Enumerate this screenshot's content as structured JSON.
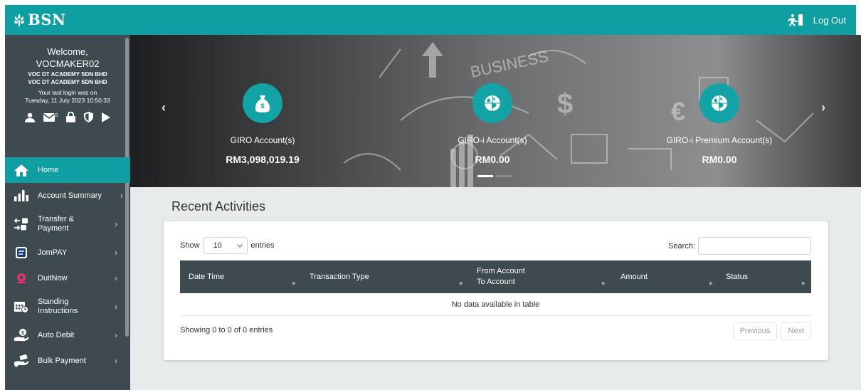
{
  "header": {
    "logo_text": "BSN",
    "logout_label": "Log Out"
  },
  "profile": {
    "welcome": "Welcome,",
    "username": "VOCMAKER02",
    "company_line1": "VOC DT ACADEMY SDN BHD",
    "company_line2": "VOC DT ACADEMY SDN BHD",
    "last_login_label": "Your last login was on",
    "last_login_time": "Tuesday, 11 July 2023 10:50:33",
    "mail_count": "0"
  },
  "sidebar": {
    "items": [
      {
        "label": "Home"
      },
      {
        "label": "Account Summary"
      },
      {
        "label_1": "Transfer &",
        "label_2": "Payment"
      },
      {
        "label": "JomPAY"
      },
      {
        "label": "DuitNow"
      },
      {
        "label_1": "Standing",
        "label_2": "Instructions"
      },
      {
        "label": "Auto Debit"
      },
      {
        "label": "Bulk Payment"
      }
    ]
  },
  "carousel": {
    "accounts": [
      {
        "title": "GIRO Account(s)",
        "amount": "RM3,098,019.19"
      },
      {
        "title": "GIRO-i Account(s)",
        "amount": "RM0.00"
      },
      {
        "title": "GIRO-i Premium Account(s)",
        "amount": "RM0.00"
      }
    ],
    "prev_symbol": "‹",
    "next_symbol": "›"
  },
  "activities": {
    "title": "Recent Activities",
    "show_label": "Show",
    "entries_value": "10",
    "entries_label": "entries",
    "search_label": "Search:",
    "search_value": "",
    "columns": {
      "date_time": "Date Time",
      "transaction_type": "Transaction Type",
      "from_account": "From Account",
      "to_account": "To Account",
      "amount": "Amount",
      "status": "Status"
    },
    "empty_message": "No data available in table",
    "info": "Showing 0 to 0 of 0 entries",
    "previous_label": "Previous",
    "next_label": "Next"
  },
  "colors": {
    "brand_teal": "#0f9ea2",
    "sidebar_bg": "#3f4a50",
    "content_bg": "#e8ebec"
  }
}
